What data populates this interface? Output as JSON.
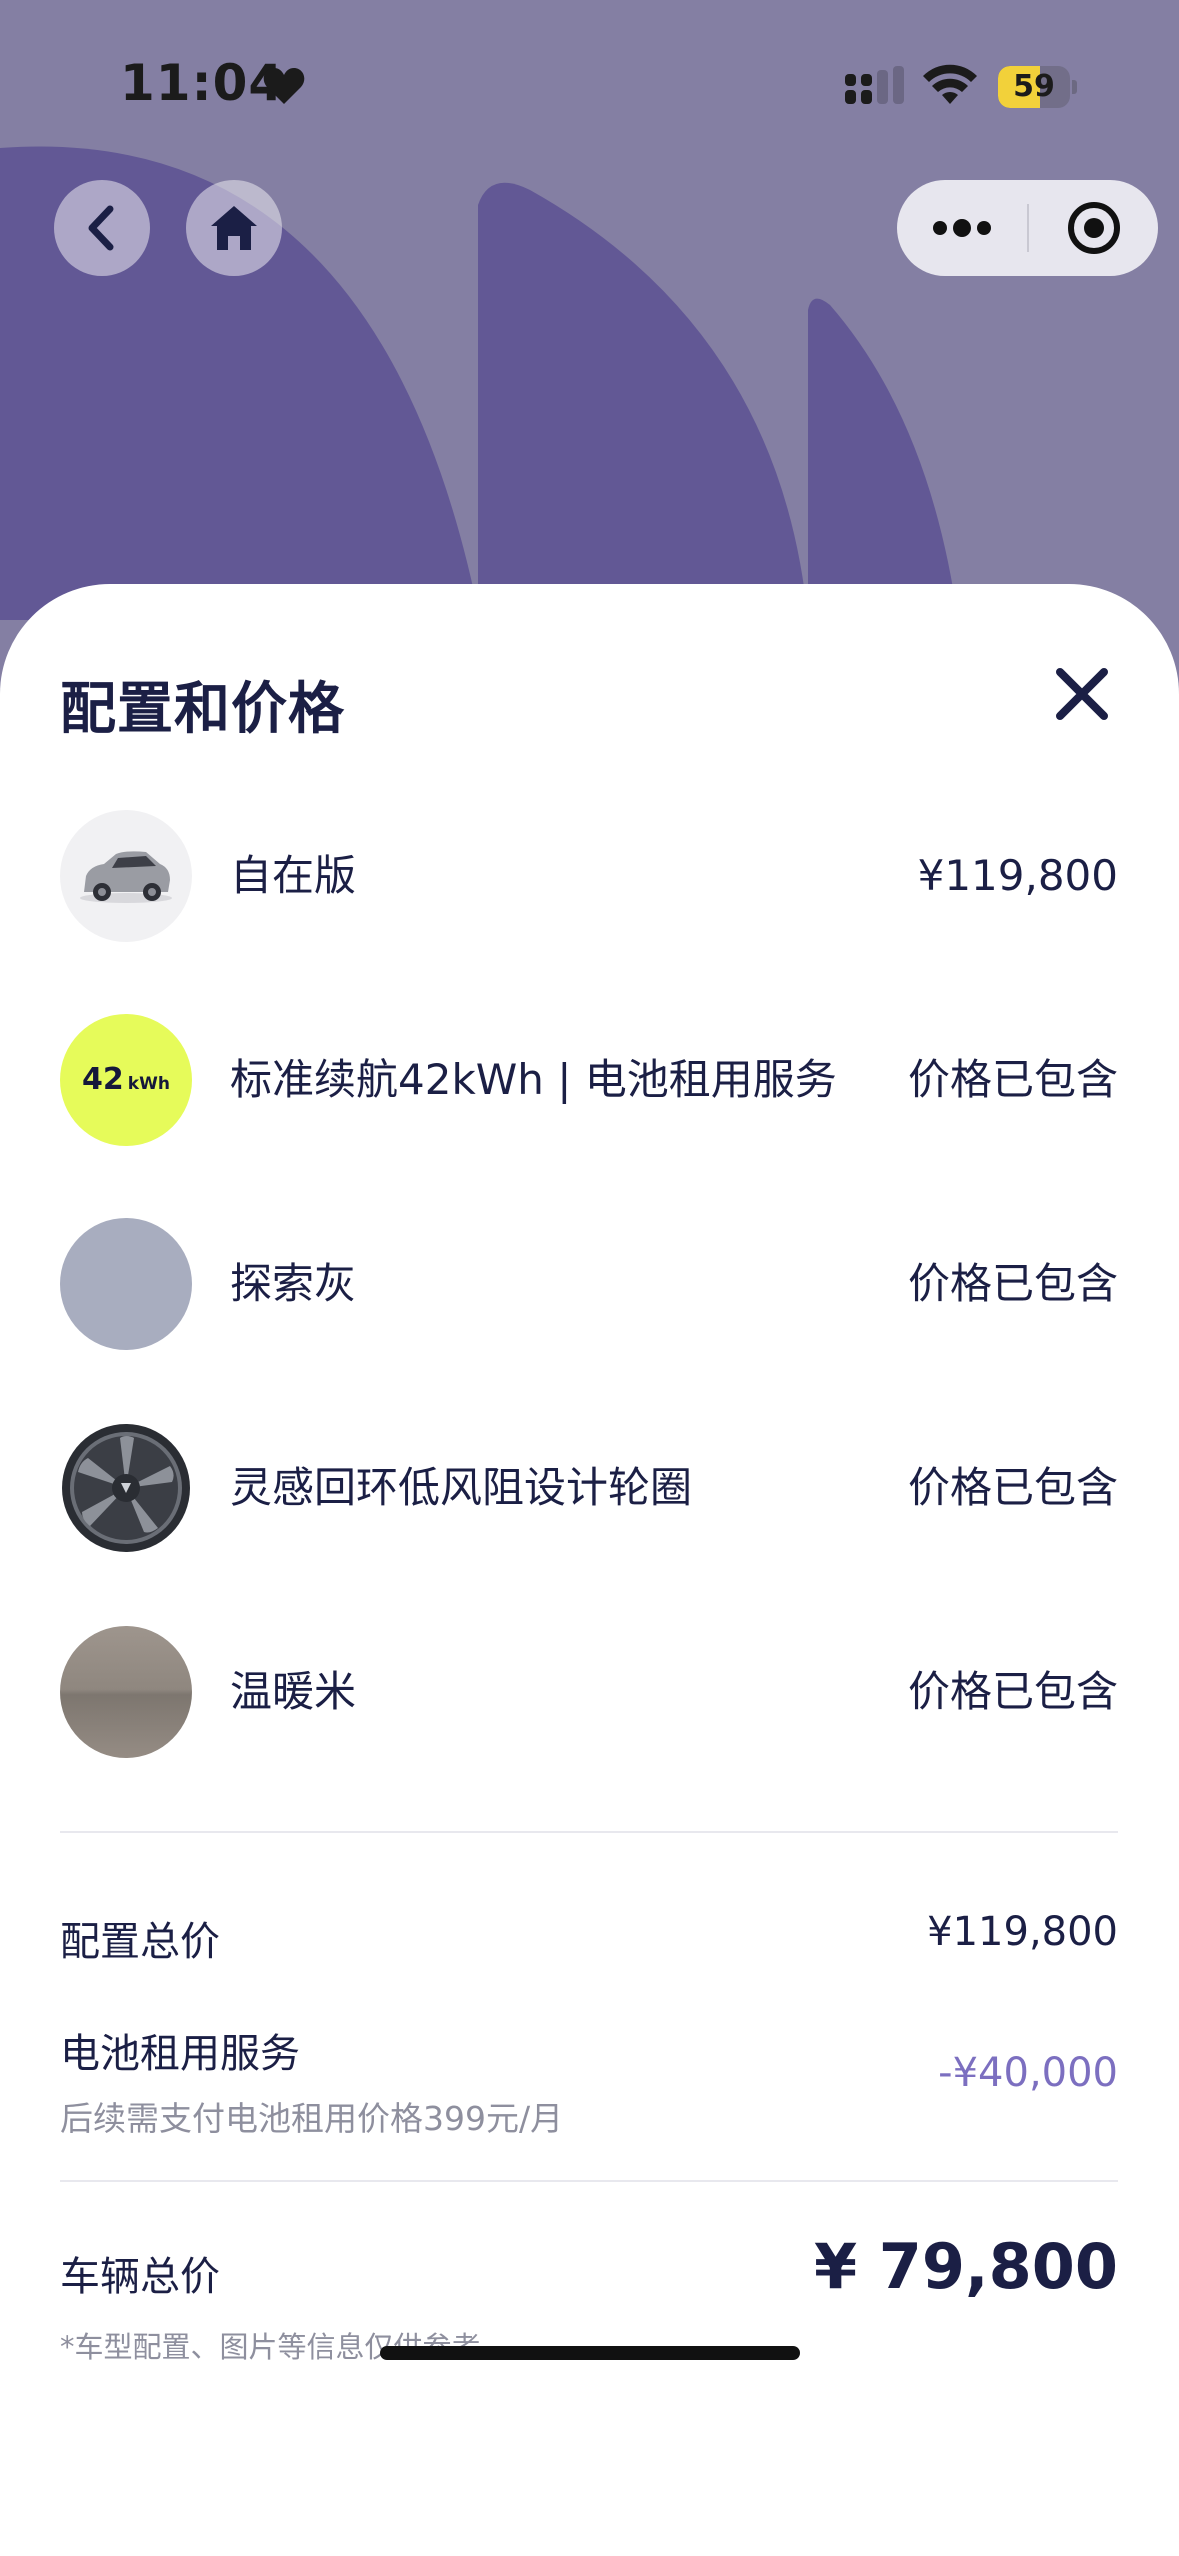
{
  "status_bar": {
    "time": "11:04",
    "battery_level": "59",
    "battery_fraction": 0.59,
    "heart_icon": "heart-icon",
    "signal_icon": "cellular-signal-icon",
    "wifi_icon": "wifi-icon"
  },
  "nav": {
    "back_icon": "chevron-left-icon",
    "home_icon": "home-icon",
    "more_icon": "more-dots-icon",
    "close_icon": "target-circle-icon"
  },
  "sheet": {
    "title": "配置和价格",
    "close_icon": "close-x-icon",
    "options": [
      {
        "name": "自在版",
        "price": "¥119,800",
        "thumb": "car-thumbnail"
      },
      {
        "name": "标准续航42kWh | 电池租用服务",
        "price": "价格已包含",
        "thumb": "battery-badge",
        "badge_big": "42",
        "badge_small": "kWh"
      },
      {
        "name": "探索灰",
        "price": "价格已包含",
        "thumb": "color-swatch"
      },
      {
        "name": "灵感回环低风阻设计轮圈",
        "price": "价格已包含",
        "thumb": "wheel-thumbnail"
      },
      {
        "name": "温暖米",
        "price": "价格已包含",
        "thumb": "interior-swatch"
      }
    ],
    "summary": {
      "config_total_label": "配置总价",
      "config_total_value": "¥119,800",
      "battery_rental_label": "电池租用服务",
      "battery_rental_note": "后续需支付电池租用价格399元/月",
      "battery_rental_value": "-¥40,000",
      "vehicle_total_label": "车辆总价",
      "vehicle_total_value": "¥ 79,800",
      "disclaimer": "*车型配置、图片等信息仅供参考"
    }
  },
  "colors": {
    "header_bg": "#847fa3",
    "deco_purple": "#625895",
    "navy_text": "#1b1f45",
    "muted_text": "#8e8f9e",
    "discount_text": "#7c6fc0",
    "badge_lime": "#e6fb5a",
    "explore_grey": "#a8adbf",
    "warm_beige": "#968d84"
  }
}
